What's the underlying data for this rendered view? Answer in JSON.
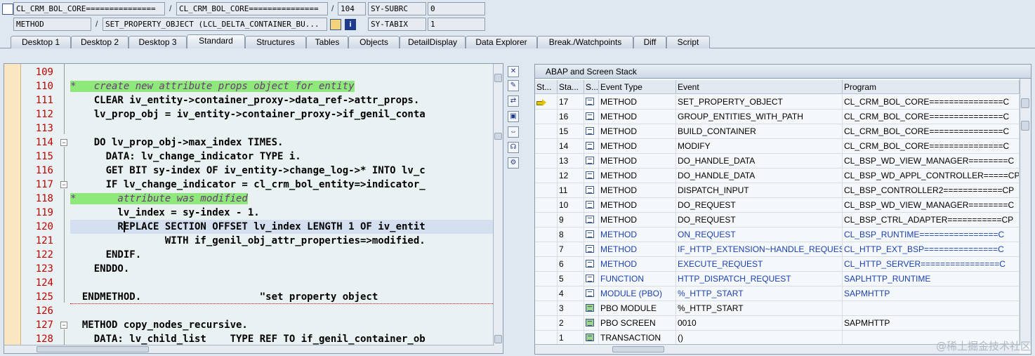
{
  "header": {
    "row1": {
      "field1": "CL_CRM_BOL_CORE===============",
      "separator1": "/",
      "field2": "CL_CRM_BOL_CORE===============",
      "separator2": "/",
      "line_no": "104",
      "var_name": "SY-SUBRC",
      "var_value": "0"
    },
    "row2": {
      "field1": "METHOD",
      "separator1": "/",
      "field2": "SET_PROPERTY_OBJECT (LCL_DELTA_CONTAINER_BU...",
      "var_name": "SY-TABIX",
      "var_value": "1"
    }
  },
  "tabs": [
    {
      "label": "Desktop 1"
    },
    {
      "label": "Desktop 2"
    },
    {
      "label": "Desktop 3"
    },
    {
      "label": "Standard"
    },
    {
      "label": "Structures"
    },
    {
      "label": "Tables"
    },
    {
      "label": "Objects"
    },
    {
      "label": "DetailDisplay"
    },
    {
      "label": "Data Explorer"
    },
    {
      "label": "Break./Watchpoints"
    },
    {
      "label": "Diff"
    },
    {
      "label": "Script"
    }
  ],
  "code": {
    "lines": [
      {
        "n": "109",
        "t": ""
      },
      {
        "n": "110",
        "t": "*   create new attribute props object for entity"
      },
      {
        "n": "111",
        "t": "    CLEAR iv_entity->container_proxy->data_ref->attr_props."
      },
      {
        "n": "112",
        "t": "    lv_prop_obj = iv_entity->container_proxy->if_genil_conta"
      },
      {
        "n": "113",
        "t": ""
      },
      {
        "n": "114",
        "t": "    DO lv_prop_obj->max_index TIMES."
      },
      {
        "n": "115",
        "t": "      DATA: lv_change_indicator TYPE i."
      },
      {
        "n": "116",
        "t": "      GET BIT sy-index OF iv_entity->change_log->* INTO lv_c"
      },
      {
        "n": "117",
        "t": "      IF lv_change_indicator = cl_crm_bol_entity=>indicator_"
      },
      {
        "n": "118",
        "t": "*       attribute was modified"
      },
      {
        "n": "119",
        "t": "        lv_index = sy-index - 1."
      },
      {
        "n": "120",
        "t": "        REPLACE SECTION OFFSET lv_index LENGTH 1 OF iv_entit"
      },
      {
        "n": "121",
        "t": "                WITH if_genil_obj_attr_properties=>modified."
      },
      {
        "n": "122",
        "t": "      ENDIF."
      },
      {
        "n": "123",
        "t": "    ENDDO."
      },
      {
        "n": "124",
        "t": ""
      },
      {
        "n": "125",
        "t": "  ENDMETHOD.                    \"set property object"
      },
      {
        "n": "126",
        "t": ""
      },
      {
        "n": "127",
        "t": "  METHOD copy_nodes_recursive."
      },
      {
        "n": "128",
        "t": "    DATA: lv_child_list    TYPE REF TO if_genil_container_ob"
      }
    ]
  },
  "stack": {
    "title": "ABAP and Screen Stack",
    "columns": [
      "St...",
      "Sta...",
      "S...",
      "Event Type",
      "Event",
      "Program"
    ],
    "rows": [
      {
        "level": "17",
        "type": "METHOD",
        "event": "SET_PROPERTY_OBJECT",
        "program": "CL_CRM_BOL_CORE===============C",
        "current": true
      },
      {
        "level": "16",
        "type": "METHOD",
        "event": "GROUP_ENTITIES_WITH_PATH",
        "program": "CL_CRM_BOL_CORE===============C"
      },
      {
        "level": "15",
        "type": "METHOD",
        "event": "BUILD_CONTAINER",
        "program": "CL_CRM_BOL_CORE===============C"
      },
      {
        "level": "14",
        "type": "METHOD",
        "event": "MODIFY",
        "program": "CL_CRM_BOL_CORE===============C"
      },
      {
        "level": "13",
        "type": "METHOD",
        "event": "DO_HANDLE_DATA",
        "program": "CL_BSP_WD_VIEW_MANAGER========C"
      },
      {
        "level": "12",
        "type": "METHOD",
        "event": "DO_HANDLE_DATA",
        "program": "CL_BSP_WD_APPL_CONTROLLER=====CP"
      },
      {
        "level": "11",
        "type": "METHOD",
        "event": "DISPATCH_INPUT",
        "program": "CL_BSP_CONTROLLER2============CP"
      },
      {
        "level": "10",
        "type": "METHOD",
        "event": "DO_REQUEST",
        "program": "CL_BSP_WD_VIEW_MANAGER========C"
      },
      {
        "level": "9",
        "type": "METHOD",
        "event": "DO_REQUEST",
        "program": "CL_BSP_CTRL_ADAPTER===========CP"
      },
      {
        "level": "8",
        "type": "METHOD",
        "event": "ON_REQUEST",
        "program": "CL_BSP_RUNTIME================C",
        "blue": true
      },
      {
        "level": "7",
        "type": "METHOD",
        "event": "IF_HTTP_EXTENSION~HANDLE_REQUEST",
        "program": "CL_HTTP_EXT_BSP===============C",
        "blue": true
      },
      {
        "level": "6",
        "type": "METHOD",
        "event": "EXECUTE_REQUEST",
        "program": "CL_HTTP_SERVER================C",
        "blue": true
      },
      {
        "level": "5",
        "type": "FUNCTION",
        "event": "HTTP_DISPATCH_REQUEST",
        "program": "SAPLHTTP_RUNTIME",
        "blue": true
      },
      {
        "level": "4",
        "type": "MODULE (PBO)",
        "event": "%_HTTP_START",
        "program": "SAPMHTTP",
        "blue": true
      },
      {
        "level": "3",
        "type": "PBO MODULE",
        "event": "%_HTTP_START",
        "program": "",
        "img": true
      },
      {
        "level": "2",
        "type": "PBO SCREEN",
        "event": "0010",
        "program": "SAPMHTTP",
        "img": true
      },
      {
        "level": "1",
        "type": "TRANSACTION",
        "event": "()",
        "program": "",
        "img": true
      }
    ]
  },
  "watermark": "@稀土掘金技术社区",
  "colors": {
    "line_numbers": "#c00000",
    "comment_highlight": "#8fe87a",
    "keyword": "#1a1aa6",
    "breakpoint_column": "#fbe6c2"
  }
}
